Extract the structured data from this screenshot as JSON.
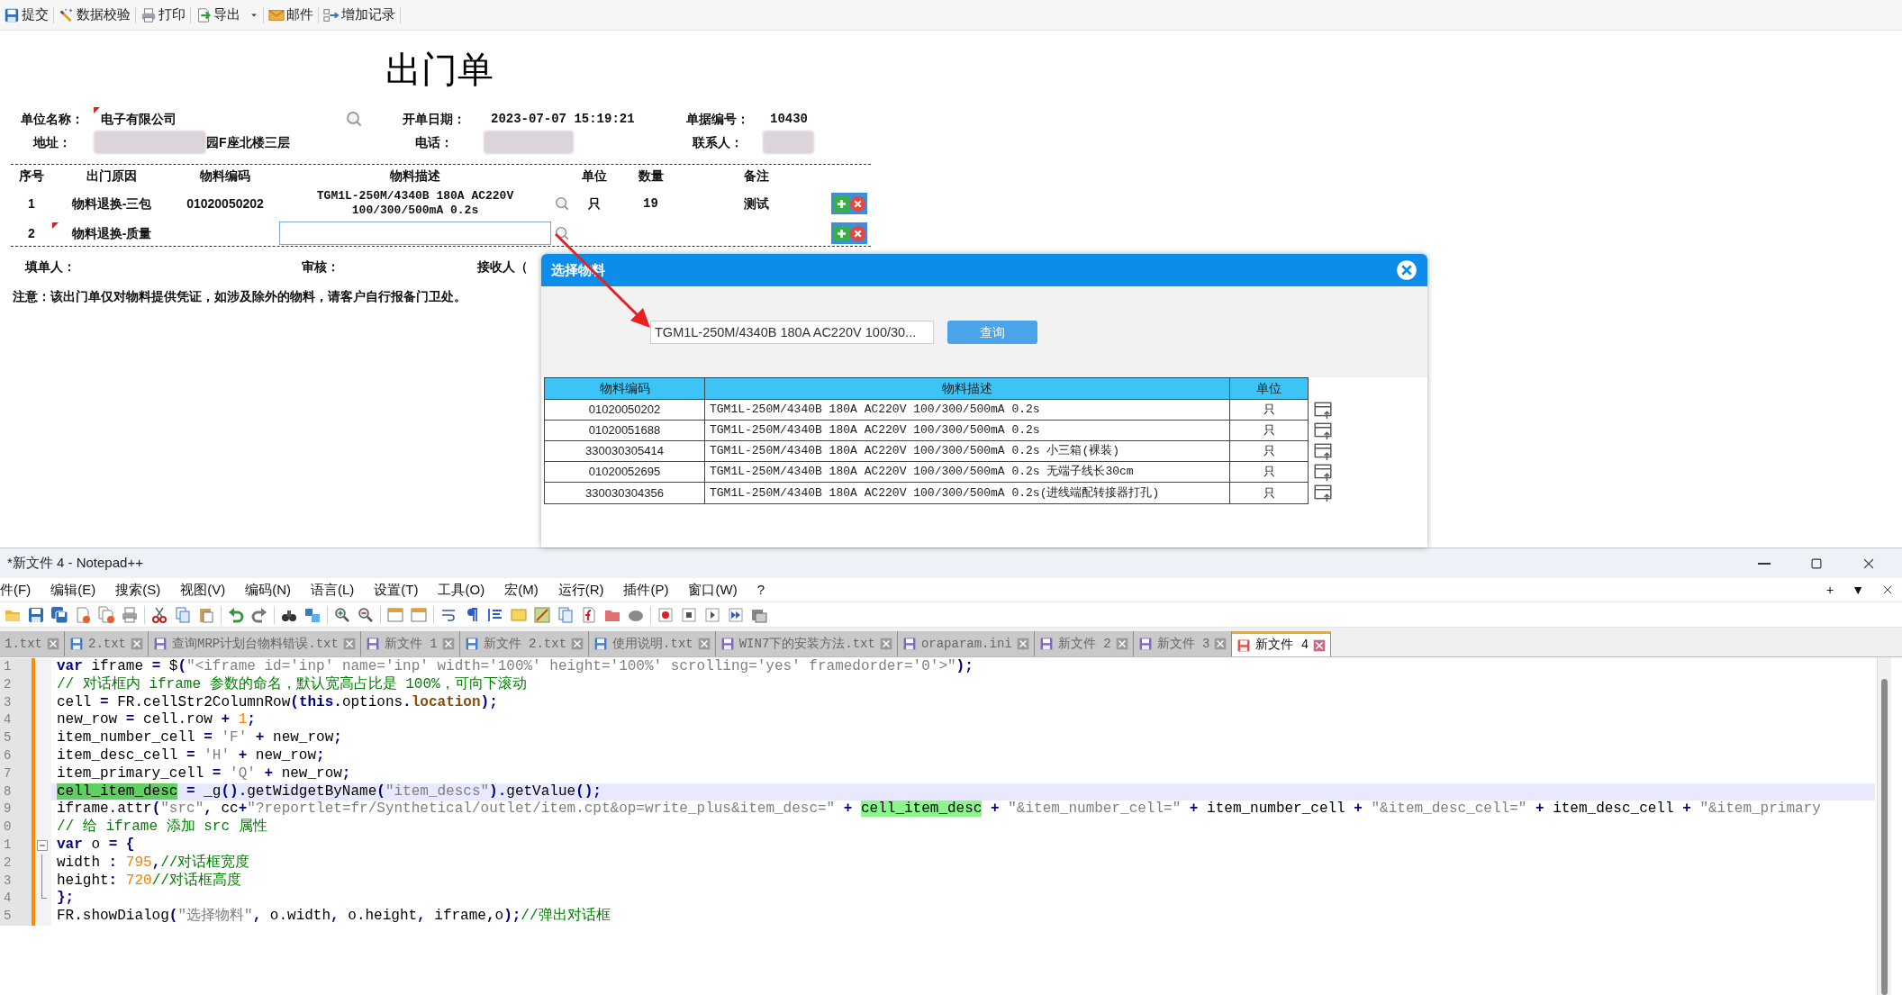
{
  "app_toolbar": [
    {
      "label": "提交",
      "dropdown": false
    },
    {
      "label": "数据校验",
      "dropdown": false
    },
    {
      "label": "打印",
      "dropdown": false
    },
    {
      "label": "导出",
      "dropdown": true
    },
    {
      "label": "邮件",
      "dropdown": false
    },
    {
      "label": "增加记录",
      "dropdown": false
    }
  ],
  "form": {
    "title": "出门单",
    "header": [
      [
        {
          "label": "单位名称：",
          "value": "电子有限公司",
          "modified": true,
          "redacted": false,
          "lookup": true
        },
        {
          "label": "开单日期：",
          "value": "2023-07-07 15:19:21",
          "modified": false,
          "redacted": false,
          "lookup": false
        },
        {
          "label": "单据编号：",
          "value": "10430",
          "modified": false,
          "redacted": false,
          "lookup": false
        }
      ],
      [
        {
          "label": "地址：",
          "value": "园F座北楼三层",
          "modified": false,
          "redacted": true,
          "lookup": false
        },
        {
          "label": "电话：",
          "modified": false,
          "redacted": true,
          "lookup": false
        },
        {
          "label": "联系人：",
          "modified": false,
          "redacted": true,
          "lookup": false
        }
      ]
    ],
    "columns": [
      "序号",
      "出门原因",
      "物料编码",
      "物料描述",
      "单位",
      "数量",
      "备注"
    ],
    "rows": [
      {
        "no": "1",
        "reason": "物料退换-三包",
        "reason_modified": false,
        "code": "01020050202",
        "desc": "TGM1L-250M/4340B 180A AC220V 100/300/500mA 0.2s",
        "editing": false,
        "unit": "只",
        "qty": "19",
        "note": "测试"
      },
      {
        "no": "2",
        "reason": "物料退换-质量",
        "reason_modified": true,
        "editing": true
      }
    ],
    "footer": [
      "填单人：",
      "审核：",
      "接收人（"
    ],
    "notice": "注意：该出门单仅对物料提供凭证，如涉及除外的物料，请客户自行报备门卫处。"
  },
  "dialog": {
    "title": "选择物料",
    "search_value": "TGM1L-250M/4340B 180A AC220V 100/30...",
    "button": "查询",
    "columns": [
      "物料编码",
      "物料描述",
      "单位"
    ],
    "rows": [
      {
        "code": "01020050202",
        "desc": "TGM1L-250M/4340B 180A AC220V 100/300/500mA 0.2s",
        "unit": "只"
      },
      {
        "code": "01020051688",
        "desc": "TGM1L-250M/4340B 180A AC220V 100/300/500mA 0.2s",
        "unit": "只"
      },
      {
        "code": "330030305414",
        "desc": "TGM1L-250M/4340B 180A AC220V 100/300/500mA 0.2s 小三箱(裸装)",
        "unit": "只"
      },
      {
        "code": "01020052695",
        "desc": "TGM1L-250M/4340B 180A AC220V 100/300/500mA 0.2s 无端子线长30cm",
        "unit": "只"
      },
      {
        "code": "330030304356",
        "desc": "TGM1L-250M/4340B 180A AC220V 100/300/500mA 0.2s(进线端配转接器打孔)",
        "unit": "只"
      }
    ]
  },
  "notepad": {
    "title": "*新文件 4 - Notepad++",
    "menu": [
      "件(F)",
      "编辑(E)",
      "搜索(S)",
      "视图(V)",
      "编码(N)",
      "语言(L)",
      "设置(T)",
      "工具(O)",
      "宏(M)",
      "运行(R)",
      "插件(P)",
      "窗口(W)",
      "?"
    ],
    "menu_right": [
      "+",
      "▼"
    ],
    "tabs": [
      {
        "label": "1.txt",
        "selected": false
      },
      {
        "label": "2.txt",
        "selected": false,
        "color": "#3d7fcf"
      },
      {
        "label": "查询MRP计划台物料错误.txt",
        "selected": false,
        "color": "#7c6bc4"
      },
      {
        "label": "新文件 1",
        "selected": false,
        "color": "#7c6bc4"
      },
      {
        "label": "新文件 2.txt",
        "selected": false,
        "color": "#3d7fcf"
      },
      {
        "label": "使用说明.txt",
        "selected": false,
        "color": "#3d7fcf"
      },
      {
        "label": "WIN7下的安装方法.txt",
        "selected": false,
        "color": "#7c6bc4"
      },
      {
        "label": "oraparam.ini",
        "selected": false,
        "color": "#7c6bc4"
      },
      {
        "label": "新文件 2",
        "selected": false,
        "color": "#7c6bc4"
      },
      {
        "label": "新文件 3",
        "selected": false,
        "color": "#7c6bc4"
      },
      {
        "label": "新文件 4",
        "selected": true,
        "color": "#e84d4d"
      }
    ],
    "lines": [
      {
        "number": "1",
        "kind": "code",
        "current": false,
        "tokens": [
          {
            "kind": "keyword",
            "text": "var"
          },
          {
            "kind": "plain",
            "text": " iframe "
          },
          {
            "kind": "operator",
            "text": "="
          },
          {
            "kind": "plain",
            "text": " $"
          },
          {
            "kind": "operator",
            "text": "("
          },
          {
            "kind": "string",
            "text": "\"<iframe id='inp' name='inp' width='100%' height='100%' scrolling='yes' framedorder='0'>\""
          },
          {
            "kind": "operator",
            "text": ");"
          }
        ]
      },
      {
        "number": "2",
        "kind": "code",
        "current": false,
        "tokens": [
          {
            "kind": "comment",
            "text": "// 对话框内 iframe 参数的命名，默认宽高占比是 100%，可向下滚动"
          }
        ]
      },
      {
        "number": "3",
        "kind": "code",
        "current": false,
        "tokens": [
          {
            "kind": "plain",
            "text": "cell "
          },
          {
            "kind": "operator",
            "text": "="
          },
          {
            "kind": "plain",
            "text": " FR.cellStr2ColumnRow"
          },
          {
            "kind": "operator",
            "text": "("
          },
          {
            "kind": "keyword",
            "text": "this"
          },
          {
            "kind": "operator",
            "text": "."
          },
          {
            "kind": "plain",
            "text": "options"
          },
          {
            "kind": "operator",
            "text": "."
          },
          {
            "kind": "property",
            "text": "location"
          },
          {
            "kind": "operator",
            "text": ");"
          }
        ]
      },
      {
        "number": "4",
        "kind": "code",
        "current": false,
        "tokens": [
          {
            "kind": "plain",
            "text": "new_row "
          },
          {
            "kind": "operator",
            "text": "="
          },
          {
            "kind": "plain",
            "text": " cell.row "
          },
          {
            "kind": "operator",
            "text": "+"
          },
          {
            "kind": "number",
            "text": " 1"
          },
          {
            "kind": "operator",
            "text": ";"
          }
        ]
      },
      {
        "number": "5",
        "kind": "code",
        "current": false,
        "tokens": [
          {
            "kind": "plain",
            "text": "item_number_cell "
          },
          {
            "kind": "operator",
            "text": "="
          },
          {
            "kind": "string",
            "text": " 'F'"
          },
          {
            "kind": "operator",
            "text": " +"
          },
          {
            "kind": "plain",
            "text": " new_row"
          },
          {
            "kind": "operator",
            "text": ";"
          }
        ]
      },
      {
        "number": "6",
        "kind": "code",
        "current": false,
        "tokens": [
          {
            "kind": "plain",
            "text": "item_desc_cell "
          },
          {
            "kind": "operator",
            "text": "="
          },
          {
            "kind": "string",
            "text": " 'H'"
          },
          {
            "kind": "operator",
            "text": " +"
          },
          {
            "kind": "plain",
            "text": " new_row"
          },
          {
            "kind": "operator",
            "text": ";"
          }
        ]
      },
      {
        "number": "7",
        "kind": "code",
        "current": false,
        "tokens": [
          {
            "kind": "plain",
            "text": "item_primary_cell "
          },
          {
            "kind": "operator",
            "text": "="
          },
          {
            "kind": "string",
            "text": " 'Q'"
          },
          {
            "kind": "operator",
            "text": " +"
          },
          {
            "kind": "plain",
            "text": " new_row"
          },
          {
            "kind": "operator",
            "text": ";"
          }
        ]
      },
      {
        "number": "8",
        "kind": "code",
        "current": true,
        "tokens": [
          {
            "kind": "selection",
            "text": "cell_item_desc"
          },
          {
            "kind": "operator",
            "text": " ="
          },
          {
            "kind": "plain",
            "text": " _g"
          },
          {
            "kind": "operator",
            "text": "()."
          },
          {
            "kind": "plain",
            "text": "getWidgetByName"
          },
          {
            "kind": "operator",
            "text": "("
          },
          {
            "kind": "string",
            "text": "\"item_descs\""
          },
          {
            "kind": "operator",
            "text": ")."
          },
          {
            "kind": "plain",
            "text": "getValue"
          },
          {
            "kind": "operator",
            "text": "();"
          }
        ]
      },
      {
        "number": "9",
        "kind": "code",
        "current": false,
        "tokens": [
          {
            "kind": "plain",
            "text": "iframe.attr"
          },
          {
            "kind": "operator",
            "text": "("
          },
          {
            "kind": "string",
            "text": "\"src\""
          },
          {
            "kind": "operator",
            "text": ","
          },
          {
            "kind": "plain",
            "text": " cc"
          },
          {
            "kind": "operator",
            "text": "+"
          },
          {
            "kind": "string",
            "text": "\"?reportlet=fr/Synthetical/outlet/item.cpt&op=write_plus&item_desc=\""
          },
          {
            "kind": "operator",
            "text": " + "
          },
          {
            "kind": "match",
            "text": "cell_item_desc"
          },
          {
            "kind": "operator",
            "text": " +"
          },
          {
            "kind": "string",
            "text": " \"&item_number_cell=\""
          },
          {
            "kind": "operator",
            "text": " +"
          },
          {
            "kind": "plain",
            "text": " item_number_cell "
          },
          {
            "kind": "operator",
            "text": "+"
          },
          {
            "kind": "string",
            "text": " \"&item_desc_cell=\""
          },
          {
            "kind": "operator",
            "text": " +"
          },
          {
            "kind": "plain",
            "text": " item_desc_cell "
          },
          {
            "kind": "operator",
            "text": "+"
          },
          {
            "kind": "string",
            "text": " \"&item_primary"
          }
        ]
      },
      {
        "number": "0",
        "kind": "code",
        "current": false,
        "tokens": [
          {
            "kind": "comment",
            "text": "// 给 iframe 添加 src 属性"
          }
        ]
      },
      {
        "number": "1",
        "kind": "fold-start",
        "current": false,
        "tokens": [
          {
            "kind": "keyword",
            "text": "var"
          },
          {
            "kind": "plain",
            "text": " o "
          },
          {
            "kind": "operator",
            "text": "= {"
          }
        ]
      },
      {
        "number": "2",
        "kind": "fold-body",
        "current": false,
        "tokens": [
          {
            "kind": "plain",
            "text": "width "
          },
          {
            "kind": "operator",
            "text": ":"
          },
          {
            "kind": "number",
            "text": " 795"
          },
          {
            "kind": "operator",
            "text": ","
          },
          {
            "kind": "comment",
            "text": "//对话框宽度"
          }
        ]
      },
      {
        "number": "3",
        "kind": "fold-body",
        "current": false,
        "tokens": [
          {
            "kind": "plain",
            "text": "height"
          },
          {
            "kind": "operator",
            "text": ":"
          },
          {
            "kind": "number",
            "text": " 720"
          },
          {
            "kind": "comment",
            "text": "//对话框高度"
          }
        ]
      },
      {
        "number": "4",
        "kind": "fold-end",
        "current": false,
        "tokens": [
          {
            "kind": "operator",
            "text": "};"
          }
        ]
      },
      {
        "number": "5",
        "kind": "code",
        "current": false,
        "tokens": [
          {
            "kind": "plain",
            "text": "FR.showDialog"
          },
          {
            "kind": "operator",
            "text": "("
          },
          {
            "kind": "string",
            "text": "\"选择物料\""
          },
          {
            "kind": "operator",
            "text": ","
          },
          {
            "kind": "plain",
            "text": " o.width"
          },
          {
            "kind": "operator",
            "text": ","
          },
          {
            "kind": "plain",
            "text": " o.height"
          },
          {
            "kind": "operator",
            "text": ","
          },
          {
            "kind": "plain",
            "text": " iframe"
          },
          {
            "kind": "operator",
            "text": ","
          },
          {
            "kind": "plain",
            "text": "o"
          },
          {
            "kind": "operator",
            "text": ");"
          },
          {
            "kind": "comment",
            "text": "//弹出对话框"
          }
        ]
      }
    ]
  }
}
